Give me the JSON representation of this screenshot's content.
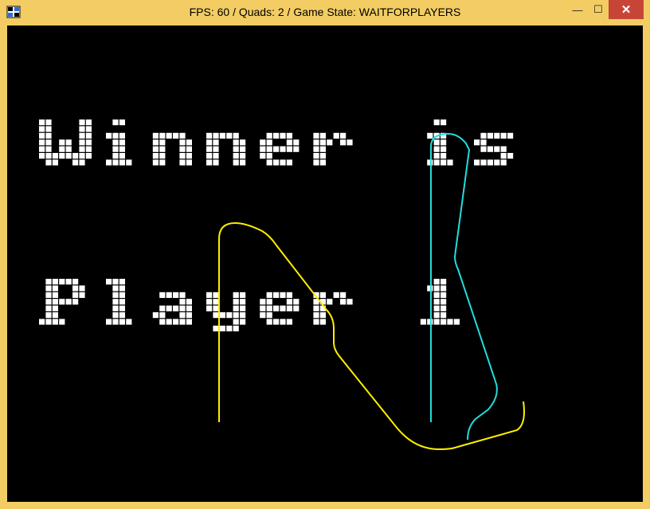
{
  "window": {
    "title": "FPS: 60 / Quads: 2 / Game State: WAITFORPLAYERS",
    "app_icon": "game-app-icon",
    "minimize_glyph": "—",
    "maximize_glyph": "☐",
    "close_glyph": "✕",
    "colors": {
      "frame": "#f3cd63",
      "close": "#c74537",
      "viewport": "#000000"
    }
  },
  "game": {
    "message_line1": "Winner is",
    "message_line2": "Player 1",
    "pixel_font_color": "#ffffff",
    "players": [
      {
        "id": 1,
        "trail_color": "#ffee00"
      },
      {
        "id": 2,
        "trail_color": "#22dddd"
      }
    ]
  }
}
